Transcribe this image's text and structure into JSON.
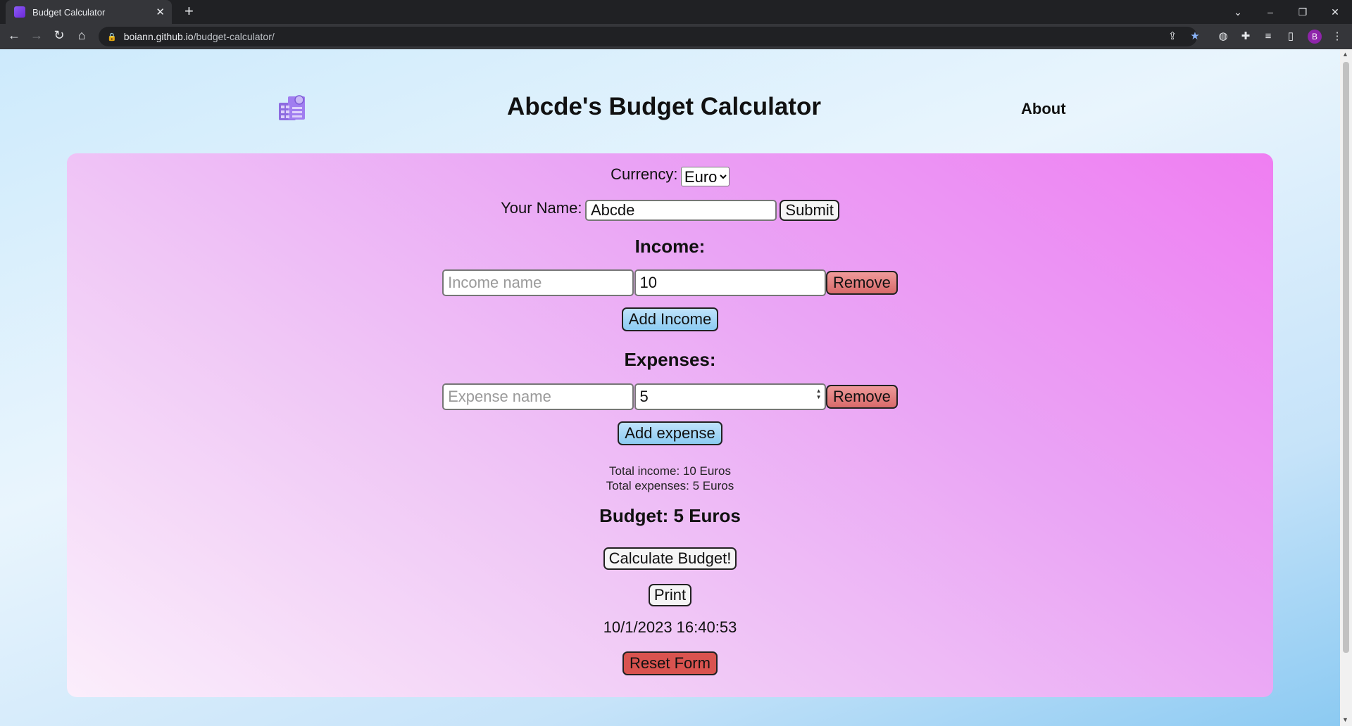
{
  "browser": {
    "tab_title": "Budget Calculator",
    "url_host": "boiann.github.io",
    "url_path": "/budget-calculator/",
    "avatar_letter": "B"
  },
  "header": {
    "title": "Abcde's Budget Calculator",
    "nav_about": "About"
  },
  "form": {
    "currency_label": "Currency:",
    "currency_value": "Euro",
    "name_label": "Your Name:",
    "name_value": "Abcde",
    "submit_label": "Submit",
    "income_heading": "Income:",
    "income_name_placeholder": "Income name",
    "income_amount_value": "10",
    "remove_label": "Remove",
    "add_income_label": "Add Income",
    "expenses_heading": "Expenses:",
    "expense_name_placeholder": "Expense name",
    "expense_amount_value": "5",
    "add_expense_label": "Add expense"
  },
  "summary": {
    "total_income": "Total income: 10 Euros",
    "total_expenses": "Total expenses: 5 Euros",
    "budget": "Budget: 5 Euros",
    "calculate_label": "Calculate Budget!",
    "print_label": "Print",
    "datetime": "10/1/2023 16:40:53",
    "reset_label": "Reset Form"
  },
  "colors": {
    "remove_button": "#d86a6a",
    "add_button": "#8ccbf2",
    "reset_button": "#d9534f"
  }
}
